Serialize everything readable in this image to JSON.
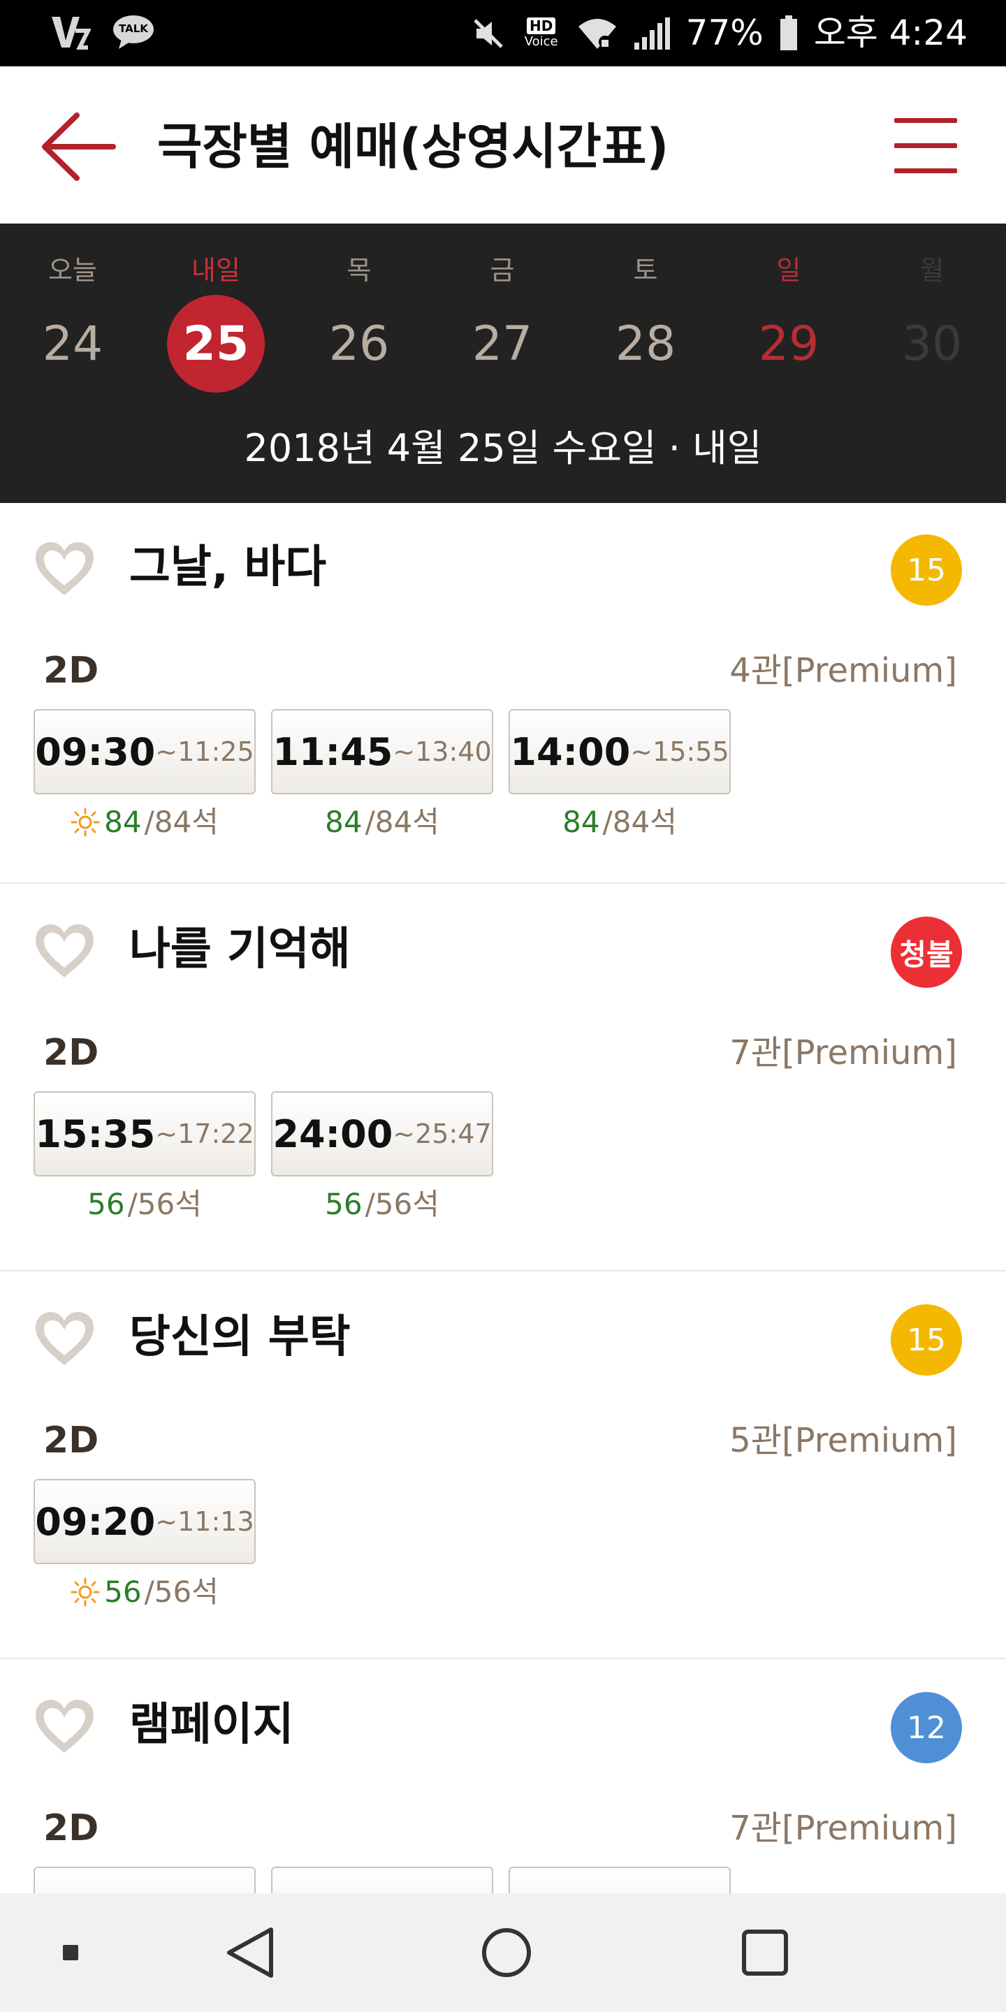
{
  "status_bar": {
    "battery": "77%",
    "time": "오후 4:24",
    "hd_label": "HD",
    "voice_label": "Voice",
    "talk_label": "TALK",
    "icons": [
      "v-app-icon",
      "kakaotalk-icon",
      "mute-icon",
      "hd-voice-icon",
      "wifi-icon",
      "signal-icon",
      "battery-icon"
    ]
  },
  "header": {
    "title": "극장별 예매(상영시간표)",
    "accent_color": "#b1222b"
  },
  "date_strip": {
    "days": [
      {
        "label": "오늘",
        "num": "24",
        "state": "normal"
      },
      {
        "label": "내일",
        "num": "25",
        "state": "selected"
      },
      {
        "label": "목",
        "num": "26",
        "state": "normal"
      },
      {
        "label": "금",
        "num": "27",
        "state": "normal"
      },
      {
        "label": "토",
        "num": "28",
        "state": "normal"
      },
      {
        "label": "일",
        "num": "29",
        "state": "sunday"
      },
      {
        "label": "월",
        "num": "30",
        "state": "disabled"
      }
    ],
    "selected_full": "2018년 4월 25일 수요일 · 내일"
  },
  "movies": [
    {
      "title": "그날, 바다",
      "rating": "15",
      "rating_color": "#f5b800",
      "format": "2D",
      "hall": "4관[Premium]",
      "showtimes": [
        {
          "start": "09:30",
          "end": "~11:25",
          "available": "84",
          "total": "/84석",
          "morning": true
        },
        {
          "start": "11:45",
          "end": "~13:40",
          "available": "84",
          "total": "/84석",
          "morning": false
        },
        {
          "start": "14:00",
          "end": "~15:55",
          "available": "84",
          "total": "/84석",
          "morning": false
        }
      ]
    },
    {
      "title": "나를 기억해",
      "rating": "청불",
      "rating_color": "#ec2f34",
      "format": "2D",
      "hall": "7관[Premium]",
      "showtimes": [
        {
          "start": "15:35",
          "end": "~17:22",
          "available": "56",
          "total": "/56석",
          "morning": false
        },
        {
          "start": "24:00",
          "end": "~25:47",
          "available": "56",
          "total": "/56석",
          "morning": false
        }
      ]
    },
    {
      "title": "당신의 부탁",
      "rating": "15",
      "rating_color": "#f5b800",
      "format": "2D",
      "hall": "5관[Premium]",
      "showtimes": [
        {
          "start": "09:20",
          "end": "~11:13",
          "available": "56",
          "total": "/56석",
          "morning": true
        }
      ]
    },
    {
      "title": "램페이지",
      "rating": "12",
      "rating_color": "#4e8fd6",
      "format": "2D",
      "hall": "7관[Premium]",
      "showtimes": []
    }
  ]
}
